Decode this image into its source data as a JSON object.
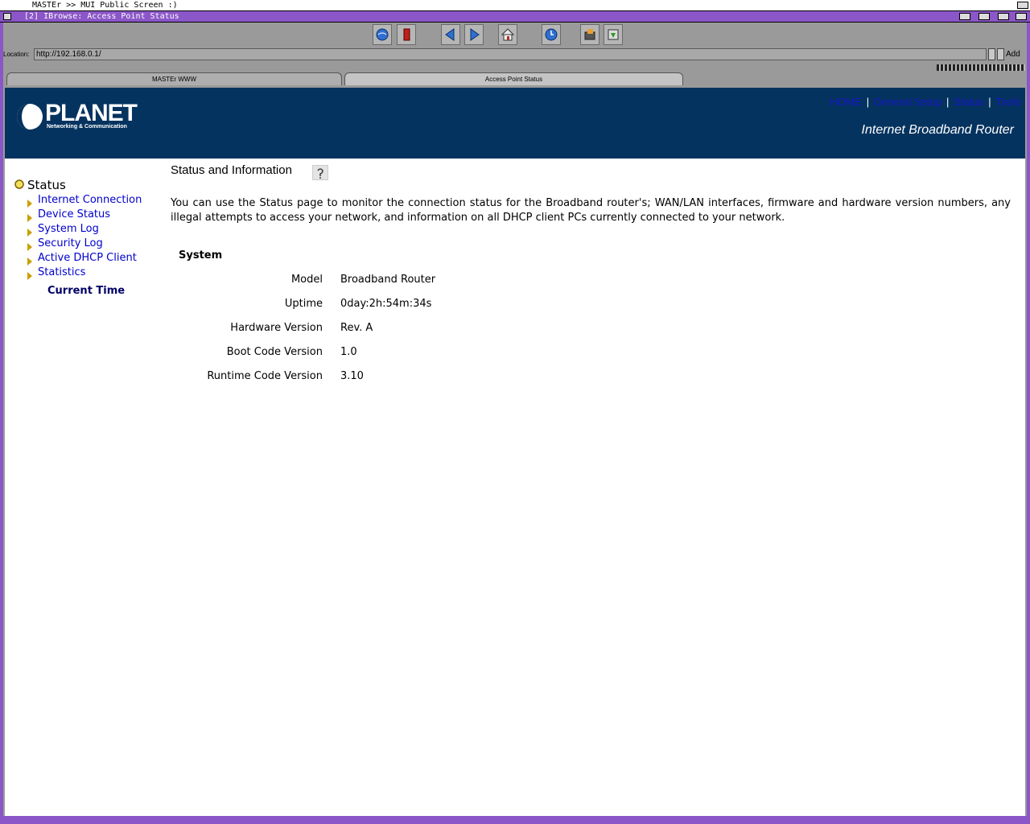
{
  "screen": {
    "title": "MASTEr >> MUI Public Screen :)"
  },
  "window": {
    "title": "[2] IBrowse: Access Point Status"
  },
  "toolbar": {
    "icons": [
      "globe-icon",
      "stop-icon",
      "back-icon",
      "forward-icon",
      "home-icon",
      "reload-icon",
      "print-icon",
      "download-icon"
    ]
  },
  "location": {
    "label": "Location:",
    "value": "http://192.168.0.1/",
    "add_label": "Add"
  },
  "tabs": [
    {
      "label": "MASTEr WWW"
    },
    {
      "label": "Access Point Status"
    }
  ],
  "banner": {
    "logo": "PLANET",
    "logo_sub": "Networking & Communication",
    "title": "Internet Broadband Router",
    "nav": [
      {
        "label": "HOME"
      },
      {
        "label": "General Setup"
      },
      {
        "label": "Status"
      },
      {
        "label": "Tools"
      }
    ]
  },
  "menu": {
    "title": "Status",
    "items": [
      {
        "label": "Internet Connection"
      },
      {
        "label": "Device Status"
      },
      {
        "label": "System Log"
      },
      {
        "label": "Security Log"
      },
      {
        "label": "Active DHCP Client"
      },
      {
        "label": "Statistics"
      }
    ],
    "current": "Current Time"
  },
  "content": {
    "title": "Status and Information",
    "description": "You can use the Status page to monitor the connection status for the Broadband router's; WAN/LAN interfaces, firmware and hardware version numbers, any illegal attempts to access your network, and information on all DHCP client PCs currently connected to your network.",
    "section": "System",
    "rows": [
      {
        "label": "Model",
        "value": "Broadband Router"
      },
      {
        "label": "Uptime",
        "value": "0day:2h:54m:34s"
      },
      {
        "label": "Hardware Version",
        "value": "Rev. A"
      },
      {
        "label": "Boot Code Version",
        "value": "1.0"
      },
      {
        "label": "Runtime Code Version",
        "value": "3.10"
      }
    ]
  },
  "colors": {
    "banner": "#05335f",
    "window_frame": "#8b56c8",
    "link": "#0000cc"
  }
}
